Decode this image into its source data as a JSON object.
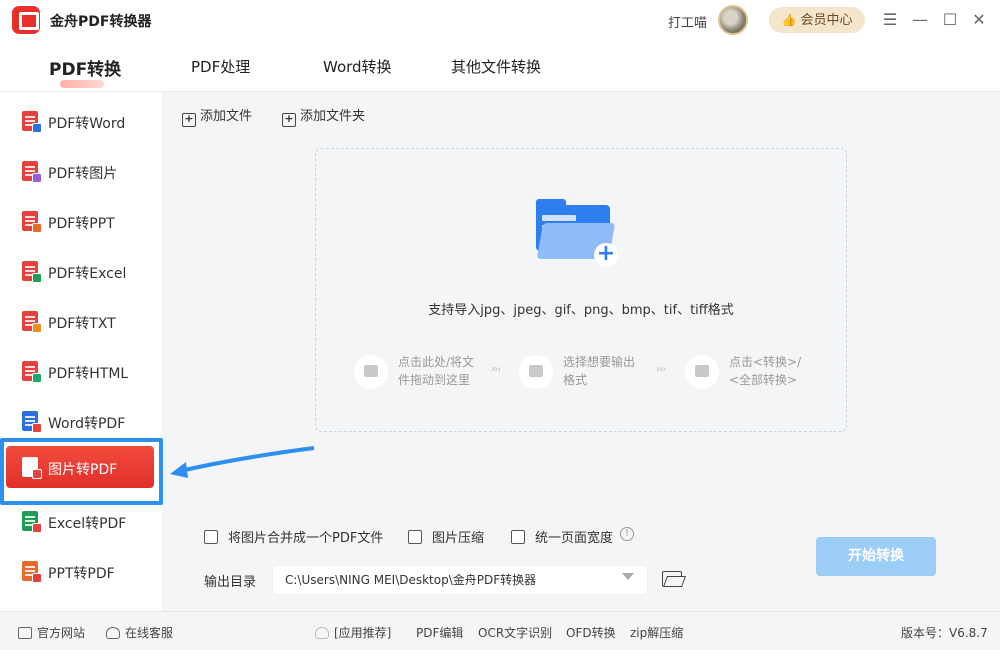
{
  "app": {
    "title": "金舟PDF转换器"
  },
  "user": {
    "name": "打工喵",
    "vip_label": "会员中心"
  },
  "tabs": [
    {
      "label": "PDF转换"
    },
    {
      "label": "PDF处理"
    },
    {
      "label": "Word转换"
    },
    {
      "label": "其他文件转换"
    }
  ],
  "sidebar": {
    "items": [
      {
        "label": "PDF转Word",
        "icon": "pdf-to-word-icon"
      },
      {
        "label": "PDF转图片",
        "icon": "pdf-to-image-icon"
      },
      {
        "label": "PDF转PPT",
        "icon": "pdf-to-ppt-icon"
      },
      {
        "label": "PDF转Excel",
        "icon": "pdf-to-excel-icon"
      },
      {
        "label": "PDF转TXT",
        "icon": "pdf-to-txt-icon"
      },
      {
        "label": "PDF转HTML",
        "icon": "pdf-to-html-icon"
      },
      {
        "label": "Word转PDF",
        "icon": "word-to-pdf-icon"
      },
      {
        "label": "图片转PDF",
        "icon": "image-to-pdf-icon",
        "selected": true
      },
      {
        "label": "Excel转PDF",
        "icon": "excel-to-pdf-icon"
      },
      {
        "label": "PPT转PDF",
        "icon": "ppt-to-pdf-icon"
      }
    ]
  },
  "toolbar": {
    "add_file": "添加文件",
    "add_folder": "添加文件夹"
  },
  "dropzone": {
    "formats_text": "支持导入jpg、jpeg、gif、png、bmp、tif、tiff格式",
    "steps": [
      {
        "text": "点击此处/将文\n件拖动到这里"
      },
      {
        "text": "选择想要输出\n格式"
      },
      {
        "text": "点击<转换>/\n<全部转换>"
      }
    ]
  },
  "options": {
    "merge_label": "将图片合并成一个PDF文件",
    "compress_label": "图片压缩",
    "uniform_width_label": "统一页面宽度"
  },
  "output": {
    "label": "输出目录",
    "path": "C:\\Users\\NING MEI\\Desktop\\金舟PDF转换器"
  },
  "start_button": "开始转换",
  "statusbar": {
    "website": "官方网站",
    "service": "在线客服",
    "recommend": "[应用推荐]",
    "links": [
      "PDF编辑",
      "OCR文字识别",
      "OFD转换",
      "zip解压缩"
    ],
    "version": "版本号：V6.8.7"
  },
  "colors": {
    "accent_red": "#e8302b",
    "highlight_blue": "#2d8ff0",
    "start_button_bg": "#9ccdf7",
    "vip_bg": "#f4e6cd"
  }
}
